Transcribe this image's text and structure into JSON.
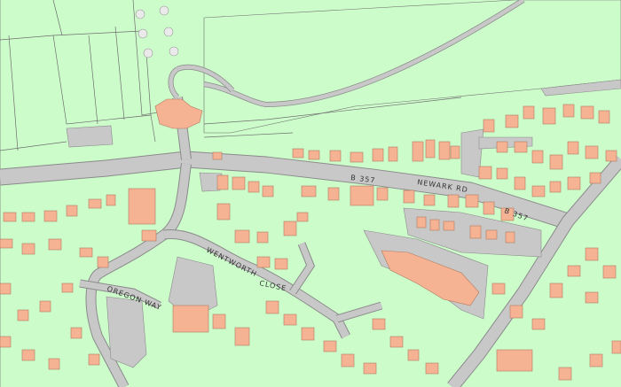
{
  "map": {
    "colors": {
      "land": "#cdfccb",
      "road": "#c8c8c8",
      "road_edge": "#8a8a8a",
      "building": "#f6b393",
      "building_edge": "#b07a5e",
      "boundary": "#6e6e6e",
      "tree": "#eaeaea"
    },
    "labels": {
      "b357_west": "B 357",
      "new_park_road": "NEWARK RD",
      "b357_east": "B 357",
      "wentworth": "WENTWORTH",
      "close": "CLOSE",
      "oregon_way": "OREGON WAY"
    }
  }
}
